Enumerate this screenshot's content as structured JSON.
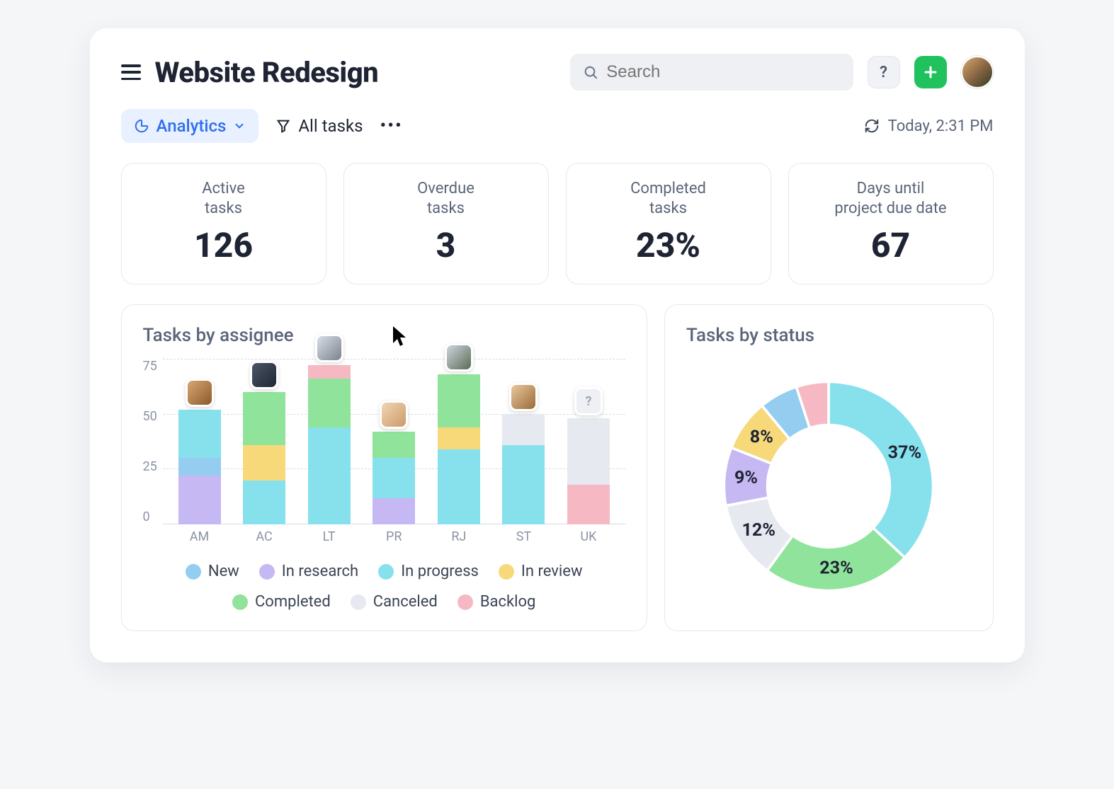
{
  "header": {
    "title": "Website Redesign",
    "search_placeholder": "Search",
    "help_label": "?"
  },
  "toolbar": {
    "analytics_label": "Analytics",
    "filter_label": "All tasks",
    "timestamp": "Today, 2:31 PM"
  },
  "stats": [
    {
      "label": "Active\ntasks",
      "value": "126"
    },
    {
      "label": "Overdue\ntasks",
      "value": "3"
    },
    {
      "label": "Completed\ntasks",
      "value": "23%"
    },
    {
      "label": "Days until\nproject due date",
      "value": "67"
    }
  ],
  "panels": {
    "assignee_title": "Tasks by assignee",
    "status_title": "Tasks by status"
  },
  "colors": {
    "new": "#94cdf0",
    "in_research": "#c6b8f2",
    "in_progress": "#86e1ed",
    "in_review": "#f7d97a",
    "completed": "#8fe39b",
    "canceled": "#e6e9f0",
    "backlog": "#f6b9c4"
  },
  "legend": [
    {
      "key": "new",
      "label": "New"
    },
    {
      "key": "in_research",
      "label": "In research"
    },
    {
      "key": "in_progress",
      "label": "In progress"
    },
    {
      "key": "in_review",
      "label": "In review"
    },
    {
      "key": "completed",
      "label": "Completed"
    },
    {
      "key": "canceled",
      "label": "Canceled"
    },
    {
      "key": "backlog",
      "label": "Backlog"
    }
  ],
  "chart_data": [
    {
      "type": "bar",
      "title": "Tasks by assignee",
      "ylim": [
        0,
        75
      ],
      "yticks": [
        0,
        25,
        50,
        75
      ],
      "categories": [
        "AM",
        "AC",
        "LT",
        "PR",
        "RJ",
        "ST",
        "UK"
      ],
      "avatars": [
        "linear-gradient(135deg,#d7a671,#8b5a2b)",
        "linear-gradient(135deg,#4a5568,#1f2733)",
        "linear-gradient(135deg,#d9dee6,#7a838f)",
        "linear-gradient(135deg,#f2d6b3,#c99a6b)",
        "linear-gradient(135deg,#cfd5dd,#5a6b55)",
        "linear-gradient(135deg,#e9c79a,#9a6b3a)",
        "?"
      ],
      "stacking_order": [
        "in_research",
        "new",
        "in_progress",
        "in_review",
        "completed",
        "backlog",
        "canceled"
      ],
      "series": {
        "AM": {
          "in_research": 22,
          "new": 8,
          "in_progress": 22
        },
        "AC": {
          "in_progress": 20,
          "in_review": 16,
          "completed": 24
        },
        "LT": {
          "in_progress": 44,
          "completed": 22,
          "backlog": 6
        },
        "PR": {
          "in_research": 12,
          "in_progress": 18,
          "completed": 12
        },
        "RJ": {
          "in_progress": 34,
          "in_review": 10,
          "completed": 24
        },
        "ST": {
          "canceled": 14,
          "in_progress": 36
        },
        "UK": {
          "canceled": 30,
          "backlog": 18
        }
      }
    },
    {
      "type": "pie",
      "title": "Tasks by status",
      "slices": [
        {
          "key": "in_progress",
          "value": 37,
          "label": "37%"
        },
        {
          "key": "completed",
          "value": 23,
          "label": "23%"
        },
        {
          "key": "canceled",
          "value": 12,
          "label": "12%"
        },
        {
          "key": "in_research",
          "value": 9,
          "label": "9%"
        },
        {
          "key": "in_review",
          "value": 8,
          "label": "8%"
        },
        {
          "key": "new",
          "value": 6,
          "label": ""
        },
        {
          "key": "backlog",
          "value": 5,
          "label": ""
        }
      ]
    }
  ]
}
